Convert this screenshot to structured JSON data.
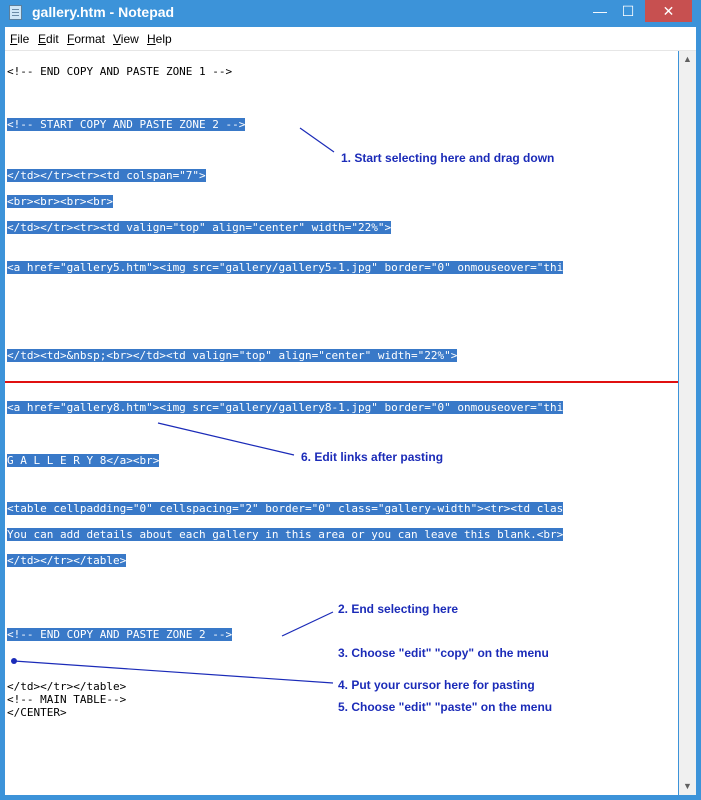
{
  "window": {
    "title": "gallery.htm - Notepad",
    "controls": {
      "minimize": "—",
      "maximize": "☐",
      "close": "✕"
    }
  },
  "menu": [
    {
      "key": "F",
      "rest": "ile"
    },
    {
      "key": "E",
      "rest": "dit"
    },
    {
      "key": "F",
      "rest": "ormat",
      "pre": ""
    },
    {
      "key": "V",
      "rest": "iew"
    },
    {
      "key": "H",
      "rest": "elp"
    }
  ],
  "menu_labels": [
    "File",
    "Edit",
    "Format",
    "View",
    "Help"
  ],
  "editor_lines": [
    {
      "text": "<!-- END COPY AND PASTE ZONE 1 -->",
      "selected": false
    },
    {
      "text": "<!-- START COPY AND PASTE ZONE 2 -->",
      "selected": true
    },
    {
      "text": "</td></tr><tr><td colspan=\"7\">",
      "selected": true
    },
    {
      "text": "<br><br><br><br>",
      "selected": true
    },
    {
      "text": "</td></tr><tr><td valign=\"top\" align=\"center\" width=\"22%\">",
      "selected": true
    },
    {
      "text": "<a href=\"gallery5.htm\"><img src=\"gallery/gallery5-1.jpg\" border=\"0\" onmouseover=\"thi",
      "selected": true
    },
    {
      "text": "</td><td>&nbsp;<br></td><td valign=\"top\" align=\"center\" width=\"22%\">",
      "selected": true
    },
    {
      "text": "<a href=\"gallery8.htm\"><img src=\"gallery/gallery8-1.jpg\" border=\"0\" onmouseover=\"thi",
      "selected": true
    },
    {
      "text": "G A L L E R Y 8</a><br>",
      "selected": true
    },
    {
      "text": "<table cellpadding=\"0\" cellspacing=\"2\" border=\"0\" class=\"gallery-width\"><tr><td clas",
      "selected": true
    },
    {
      "text": "You can add details about each gallery in this area or you can leave this blank.<br>",
      "selected": true
    },
    {
      "text": "</td></tr></table>",
      "selected": true
    },
    {
      "text": "<!-- END COPY AND PASTE ZONE 2 -->",
      "selected": true
    },
    {
      "text": "</td></tr></table>",
      "selected": false
    },
    {
      "text": "<!-- MAIN TABLE-->",
      "selected": false
    },
    {
      "text": "</CENTER>",
      "selected": false
    }
  ],
  "annotations": [
    "1. Start selecting here and drag down",
    "6. Edit links after pasting",
    "2. End selecting here",
    "3. Choose \"edit\" \"copy\" on the menu",
    "4. Put your cursor here for pasting",
    "5. Choose \"edit\" \"paste\" on the menu"
  ],
  "colors": {
    "titlebar": "#3c93d9",
    "selection": "#3979c8",
    "annotation": "#1b2bb8",
    "divider": "#e01010",
    "close": "#c75050"
  },
  "icons": {
    "app": "notepad-icon",
    "scroll_up": "▲",
    "scroll_down": "▼"
  }
}
